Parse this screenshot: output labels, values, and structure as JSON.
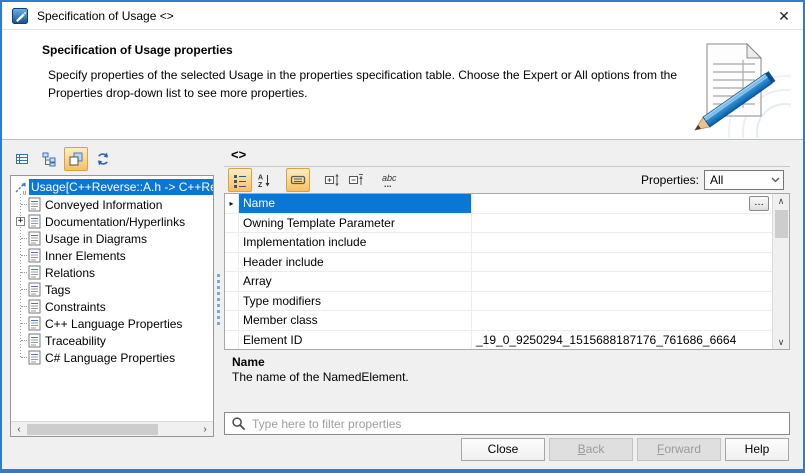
{
  "window": {
    "title": "Specification of Usage <>"
  },
  "header": {
    "title": "Specification of Usage properties",
    "description": "Specify properties of the selected Usage in the properties specification table. Choose the Expert or All options from the Properties drop-down list to see more properties."
  },
  "left": {
    "root": "Usage[C++Reverse::A.h -> C++Re",
    "items": [
      "Conveyed Information",
      "Documentation/Hyperlinks",
      "Usage in Diagrams",
      "Inner Elements",
      "Relations",
      "Tags",
      "Constraints",
      "C++ Language Properties",
      "Traceability",
      "C# Language Properties"
    ]
  },
  "right": {
    "element_header": "<>",
    "properties_label": "Properties:",
    "properties_value": "All",
    "rows": [
      {
        "name": "Name",
        "value": ""
      },
      {
        "name": "Owning Template Parameter",
        "value": ""
      },
      {
        "name": "Implementation include",
        "value": ""
      },
      {
        "name": "Header include",
        "value": ""
      },
      {
        "name": "Array",
        "value": ""
      },
      {
        "name": "Type modifiers",
        "value": ""
      },
      {
        "name": "Member class",
        "value": ""
      },
      {
        "name": "Element ID",
        "value": "_19_0_9250294_1515688187176_761686_6664"
      }
    ],
    "description_title": "Name",
    "description_text": "The name of the NamedElement.",
    "filter_placeholder": "Type here to filter properties"
  },
  "buttons": {
    "close": "Close",
    "back": "Back",
    "forward": "Forward",
    "help": "Help"
  },
  "icons": {
    "close": "✕",
    "dots": "…",
    "row_marker": "▸",
    "expander_plus": "+",
    "scroll_up": "∧",
    "scroll_down": "∨",
    "scroll_left": "‹",
    "scroll_right": "›",
    "combo_chevron": "∨"
  },
  "colors": {
    "window_border": "#2a7dd2",
    "selection": "#0a77d5",
    "toggle_orange": "#f8c064"
  }
}
